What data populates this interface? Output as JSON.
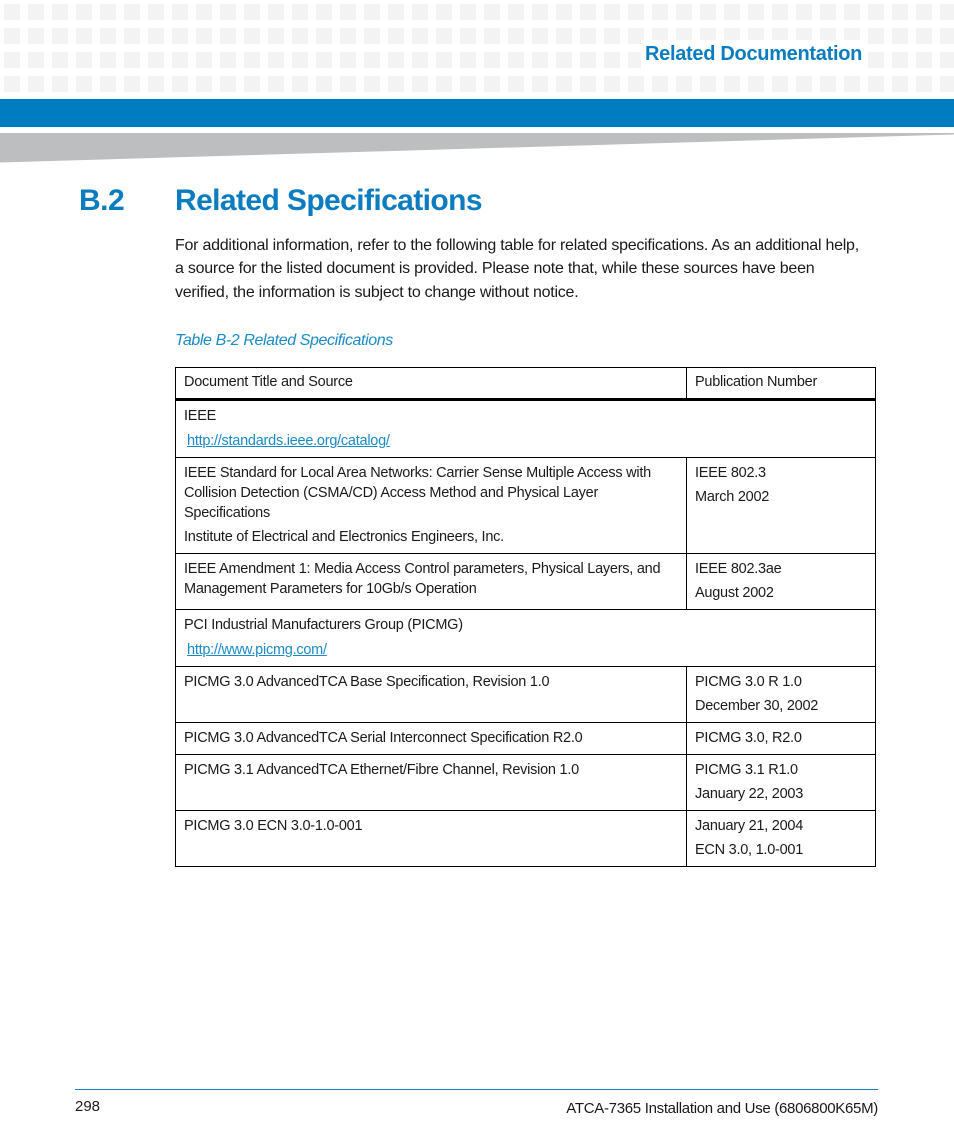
{
  "header": {
    "running_title": "Related Documentation"
  },
  "section": {
    "number": "B.2",
    "title": "Related Specifications",
    "intro": "For additional information, refer to the following table for related specifications. As an additional help, a source for the listed document is provided. Please note that, while these sources have been verified, the information is subject to change without notice."
  },
  "table": {
    "caption": "Table B-2 Related Specifications",
    "columns": [
      "Document Title and Source",
      "Publication Number"
    ],
    "groups": [
      {
        "name": "IEEE",
        "link": "http://standards.ieee.org/catalog/",
        "rows": [
          {
            "title_lines": [
              "IEEE Standard for Local Area Networks: Carrier Sense Multiple Access with Collision Detection (CSMA/CD) Access Method and Physical Layer Specifications",
              "Institute of Electrical and Electronics Engineers, Inc."
            ],
            "publication_lines": [
              "IEEE 802.3",
              "March 2002"
            ]
          },
          {
            "title_lines": [
              "IEEE Amendment 1: Media Access Control parameters, Physical Layers, and Management Parameters for 10Gb/s Operation"
            ],
            "publication_lines": [
              "IEEE 802.3ae",
              "August 2002"
            ]
          }
        ]
      },
      {
        "name": "PCI Industrial Manufacturers Group (PICMG)",
        "link": "http://www.picmg.com/",
        "rows": [
          {
            "title_lines": [
              "PICMG 3.0 AdvancedTCA Base Specification, Revision 1.0"
            ],
            "publication_lines": [
              "PICMG 3.0 R 1.0",
              "December 30, 2002"
            ]
          },
          {
            "title_lines": [
              "PICMG 3.0 AdvancedTCA Serial Interconnect Specification R2.0"
            ],
            "publication_lines": [
              "PICMG 3.0, R2.0"
            ]
          },
          {
            "title_lines": [
              "PICMG 3.1 AdvancedTCA Ethernet/Fibre Channel, Revision 1.0"
            ],
            "publication_lines": [
              "PICMG 3.1 R1.0",
              "January 22, 2003"
            ]
          },
          {
            "title_lines": [
              "PICMG 3.0 ECN 3.0-1.0-001"
            ],
            "publication_lines": [
              "January 21, 2004",
              "ECN 3.0, 1.0-001"
            ]
          }
        ]
      }
    ]
  },
  "footer": {
    "page_number": "298",
    "document_title": "ATCA-7365 Installation and Use (6806800K65M)"
  },
  "colors": {
    "brand_blue": "#007dc0",
    "heading_blue": "#0a7cbf",
    "link_blue": "#1a8ac8",
    "wedge_gray": "#bdbec0",
    "grid_square_gray": "#f3f3f3"
  }
}
